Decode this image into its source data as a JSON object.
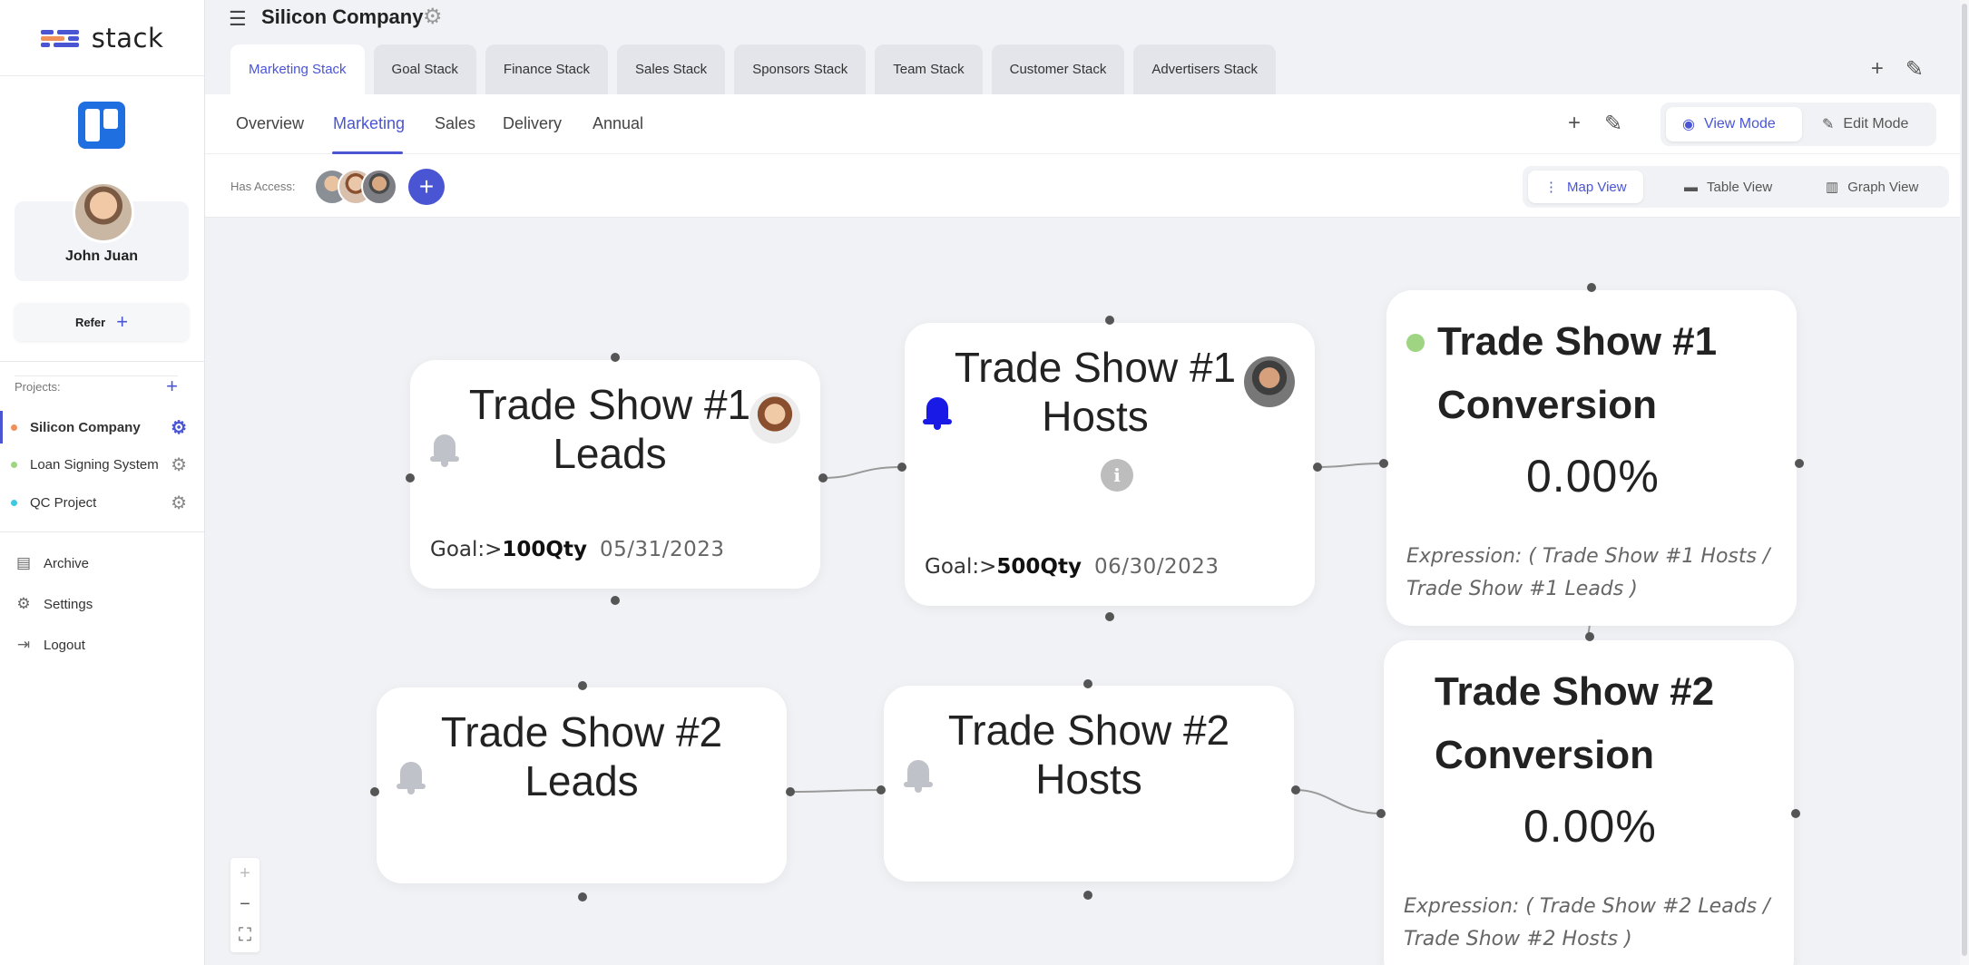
{
  "brand": {
    "name": "stack"
  },
  "profile": {
    "name": "John Juan"
  },
  "refer": {
    "label": "Refer",
    "plus": "+"
  },
  "projects": {
    "heading": "Projects:",
    "add": "+",
    "items": [
      {
        "label": "Silicon Company",
        "color": "#f0915a"
      },
      {
        "label": "Loan Signing System",
        "color": "#9fd582"
      },
      {
        "label": "QC Project",
        "color": "#3fc8e0"
      }
    ]
  },
  "nav": {
    "archive": "Archive",
    "settings": "Settings",
    "logout": "Logout"
  },
  "header": {
    "title": "Silicon Company",
    "stack_tabs": [
      "Marketing Stack",
      "Goal Stack",
      "Finance Stack",
      "Sales Stack",
      "Sponsors Stack",
      "Team Stack",
      "Customer Stack",
      "Advertisers Stack"
    ]
  },
  "subnav": {
    "tabs": [
      "Overview",
      "Marketing",
      "Sales",
      "Delivery",
      "Annual"
    ],
    "view_mode": "View Mode",
    "edit_mode": "Edit Mode"
  },
  "access": {
    "label": "Has Access:",
    "add": "+",
    "map_view": "Map View",
    "table_view": "Table View",
    "graph_view": "Graph View"
  },
  "nodes": {
    "ts1_leads": {
      "title_line1": "Trade Show #1",
      "title_line2": "Leads",
      "goal_prefix": "Goal:>",
      "goal_value": "100Qty",
      "date": "05/31/2023"
    },
    "ts1_hosts": {
      "title_line1": "Trade Show #1",
      "title_line2": "Hosts",
      "info": "i",
      "goal_prefix": "Goal:>",
      "goal_value": "500Qty",
      "date": "06/30/2023"
    },
    "ts1_conversion": {
      "title_line1": "Trade Show #1",
      "title_line2": "Conversion",
      "percent": "0.00%",
      "expression_line1": "Expression: ( Trade Show #1 Hosts /",
      "expression_line2": "Trade Show #1 Leads )"
    },
    "ts2_leads": {
      "title_line1": "Trade Show #2",
      "title_line2": "Leads"
    },
    "ts2_hosts": {
      "title_line1": "Trade Show #2",
      "title_line2": "Hosts"
    },
    "ts2_conversion": {
      "title_line1": "Trade Show #2",
      "title_line2": "Conversion",
      "percent": "0.00%",
      "expression_line1": "Expression: ( Trade Show #2 Leads /",
      "expression_line2": "Trade Show #2 Hosts )"
    }
  },
  "zoom": {
    "in": "+",
    "out": "−",
    "fit": "⛶"
  },
  "colors": {
    "accent": "#4a55d4",
    "bell_active": "#1a1ae6",
    "bell_inactive": "#bcbec6",
    "status_green": "#9fd582"
  }
}
